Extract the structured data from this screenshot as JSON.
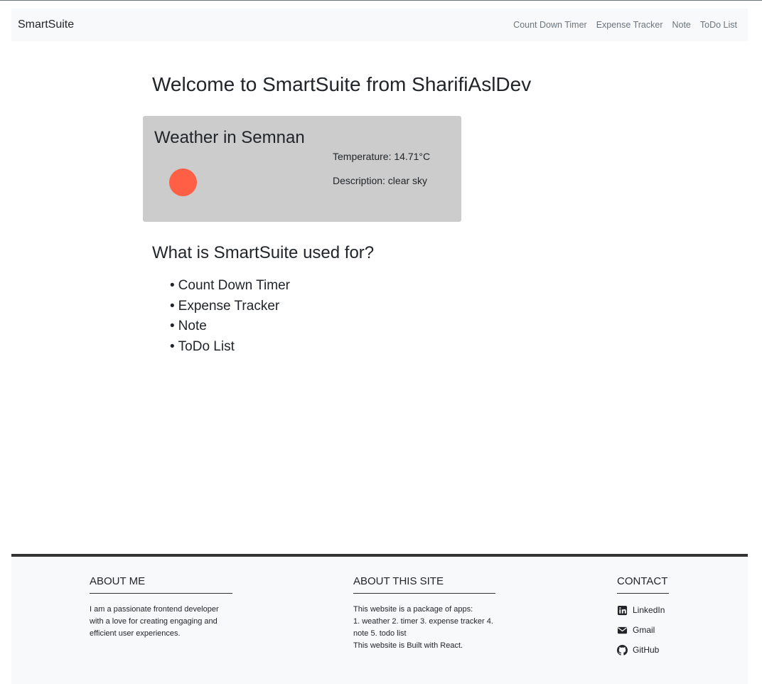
{
  "navbar": {
    "brand": "SmartSuite",
    "links": [
      {
        "label": "Count Down Timer"
      },
      {
        "label": "Expense Tracker"
      },
      {
        "label": "Note"
      },
      {
        "label": "ToDo List"
      }
    ]
  },
  "main": {
    "welcome": "Welcome to SmartSuite from SharifiAslDev",
    "weather": {
      "title": "Weather in Semnan",
      "temperature": "Temperature: 14.71°C",
      "description": "Description: clear sky",
      "icon": "sun-icon",
      "icon_color": "#ff5f45"
    },
    "usage_title": "What is SmartSuite used for?",
    "usage_items": [
      "Count Down Timer",
      "Expense Tracker",
      "Note",
      "ToDo List"
    ]
  },
  "footer": {
    "about_me": {
      "title": "ABOUT ME",
      "text": "I am a passionate frontend developer with a love for creating engaging and efficient user experiences."
    },
    "about_site": {
      "title": "ABOUT THIS SITE",
      "line1": "This website is a package of apps:",
      "line2": "1. weather 2. timer 3. expense tracker 4. note 5. todo list",
      "line3": "This website is Built with React."
    },
    "contact": {
      "title": "CONTACT",
      "items": [
        {
          "icon": "linkedin-icon",
          "label": "LinkedIn"
        },
        {
          "icon": "mail-icon",
          "label": "Gmail"
        },
        {
          "icon": "github-icon",
          "label": "GitHub"
        }
      ]
    }
  },
  "colors": {
    "navbar_bg": "#f8f9fa",
    "card_bg": "#cccccc",
    "footer_bg": "#f8f9fa",
    "muted_text": "#6c757d"
  }
}
